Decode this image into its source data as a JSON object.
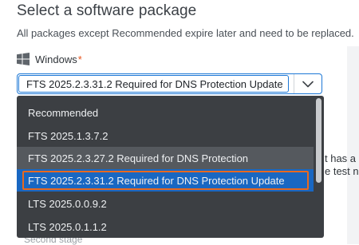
{
  "heading": "Select a software package",
  "subtitle": "All packages except Recommended expire later and need to be replaced.",
  "platform": {
    "label": "Windows",
    "required_marker": "*"
  },
  "select": {
    "value": "FTS 2025.2.3.31.2 Required for DNS Protection Update"
  },
  "dropdown": {
    "options": [
      {
        "label": "Recommended",
        "state": "normal"
      },
      {
        "label": "FTS 2025.1.3.7.2",
        "state": "normal"
      },
      {
        "label": "FTS 2025.2.3.27.2 Required for DNS Protection",
        "state": "hover"
      },
      {
        "label": "FTS 2025.2.3.31.2 Required for DNS Protection Update",
        "state": "selected"
      },
      {
        "label": "LTS 2025.0.0.9.2",
        "state": "normal"
      },
      {
        "label": "LTS 2025.0.1.1.2",
        "state": "normal"
      }
    ]
  },
  "background_text": {
    "line1": "t has a",
    "line2": "e test ne",
    "bottom": "Second stage"
  },
  "colors": {
    "accent_blue": "#1d78d6",
    "selected_bg": "#1967c2",
    "highlight_orange": "#e8691f",
    "required_red": "#e8521a",
    "dropdown_bg": "#3c3f43"
  },
  "icons": {
    "platform": "windows-icon",
    "select": "chevron-down-icon"
  }
}
